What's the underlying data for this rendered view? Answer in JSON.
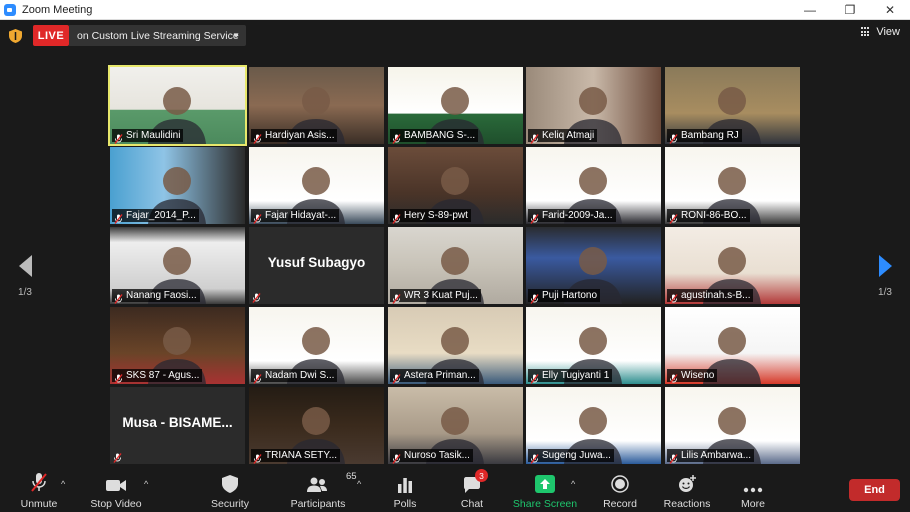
{
  "window": {
    "title": "Zoom Meeting",
    "minimize": "—",
    "maximize": "❐",
    "close": "✕"
  },
  "live": {
    "badge": "LIVE",
    "service": "on Custom Live Streaming Service"
  },
  "view": {
    "label": "View"
  },
  "pager": {
    "left": "1/3",
    "right": "1/3"
  },
  "participants": [
    {
      "name": "Sri Maulidini",
      "active": true
    },
    {
      "name": "Hardiyan Asis..."
    },
    {
      "name": "BAMBANG S-..."
    },
    {
      "name": "Keliq Atmaji"
    },
    {
      "name": "Bambang RJ"
    },
    {
      "name": "Fajar_2014_P..."
    },
    {
      "name": "Fajar Hidayat-..."
    },
    {
      "name": "Hery S-89-pwt"
    },
    {
      "name": "Farid-2009-Ja..."
    },
    {
      "name": "RONI-86-BO..."
    },
    {
      "name": "Nanang Faosi..."
    },
    {
      "name": "Yusuf Subagyo",
      "video_off": true
    },
    {
      "name": "WR 3 Kuat Puj..."
    },
    {
      "name": "Puji Hartono"
    },
    {
      "name": "agustinah.s-B..."
    },
    {
      "name": "SKS 87 - Agus..."
    },
    {
      "name": "Nadam Dwi S..."
    },
    {
      "name": "Astera Priman..."
    },
    {
      "name": "Elly Tugiyanti 1"
    },
    {
      "name": "Wiseno"
    },
    {
      "name": "Musa  -  BISAME...",
      "video_off": true
    },
    {
      "name": "TRIANA SETY..."
    },
    {
      "name": "Nuroso Tasik..."
    },
    {
      "name": "Sugeng Juwa..."
    },
    {
      "name": "Lilis Ambarwa..."
    }
  ],
  "toolbar": {
    "unmute": "Unmute",
    "stop_video": "Stop Video",
    "security": "Security",
    "participants": "Participants",
    "participants_count": "65",
    "polls": "Polls",
    "chat": "Chat",
    "chat_badge": "3",
    "share_screen": "Share Screen",
    "record": "Record",
    "reactions": "Reactions",
    "more": "More",
    "end": "End"
  },
  "colors": {
    "live": "#e02828",
    "active_speaker": "#e8e86c",
    "share": "#1ec66d",
    "end": "#c22b2b",
    "pager_next": "#2d8cff"
  },
  "icons": [
    "zoom-app-icon",
    "shield-icon",
    "grid-view-icon",
    "muted-mic-icon",
    "video-icon",
    "security-shield-icon",
    "participants-icon",
    "polls-icon",
    "chat-icon",
    "share-screen-icon",
    "record-icon",
    "reactions-icon",
    "more-icon"
  ]
}
